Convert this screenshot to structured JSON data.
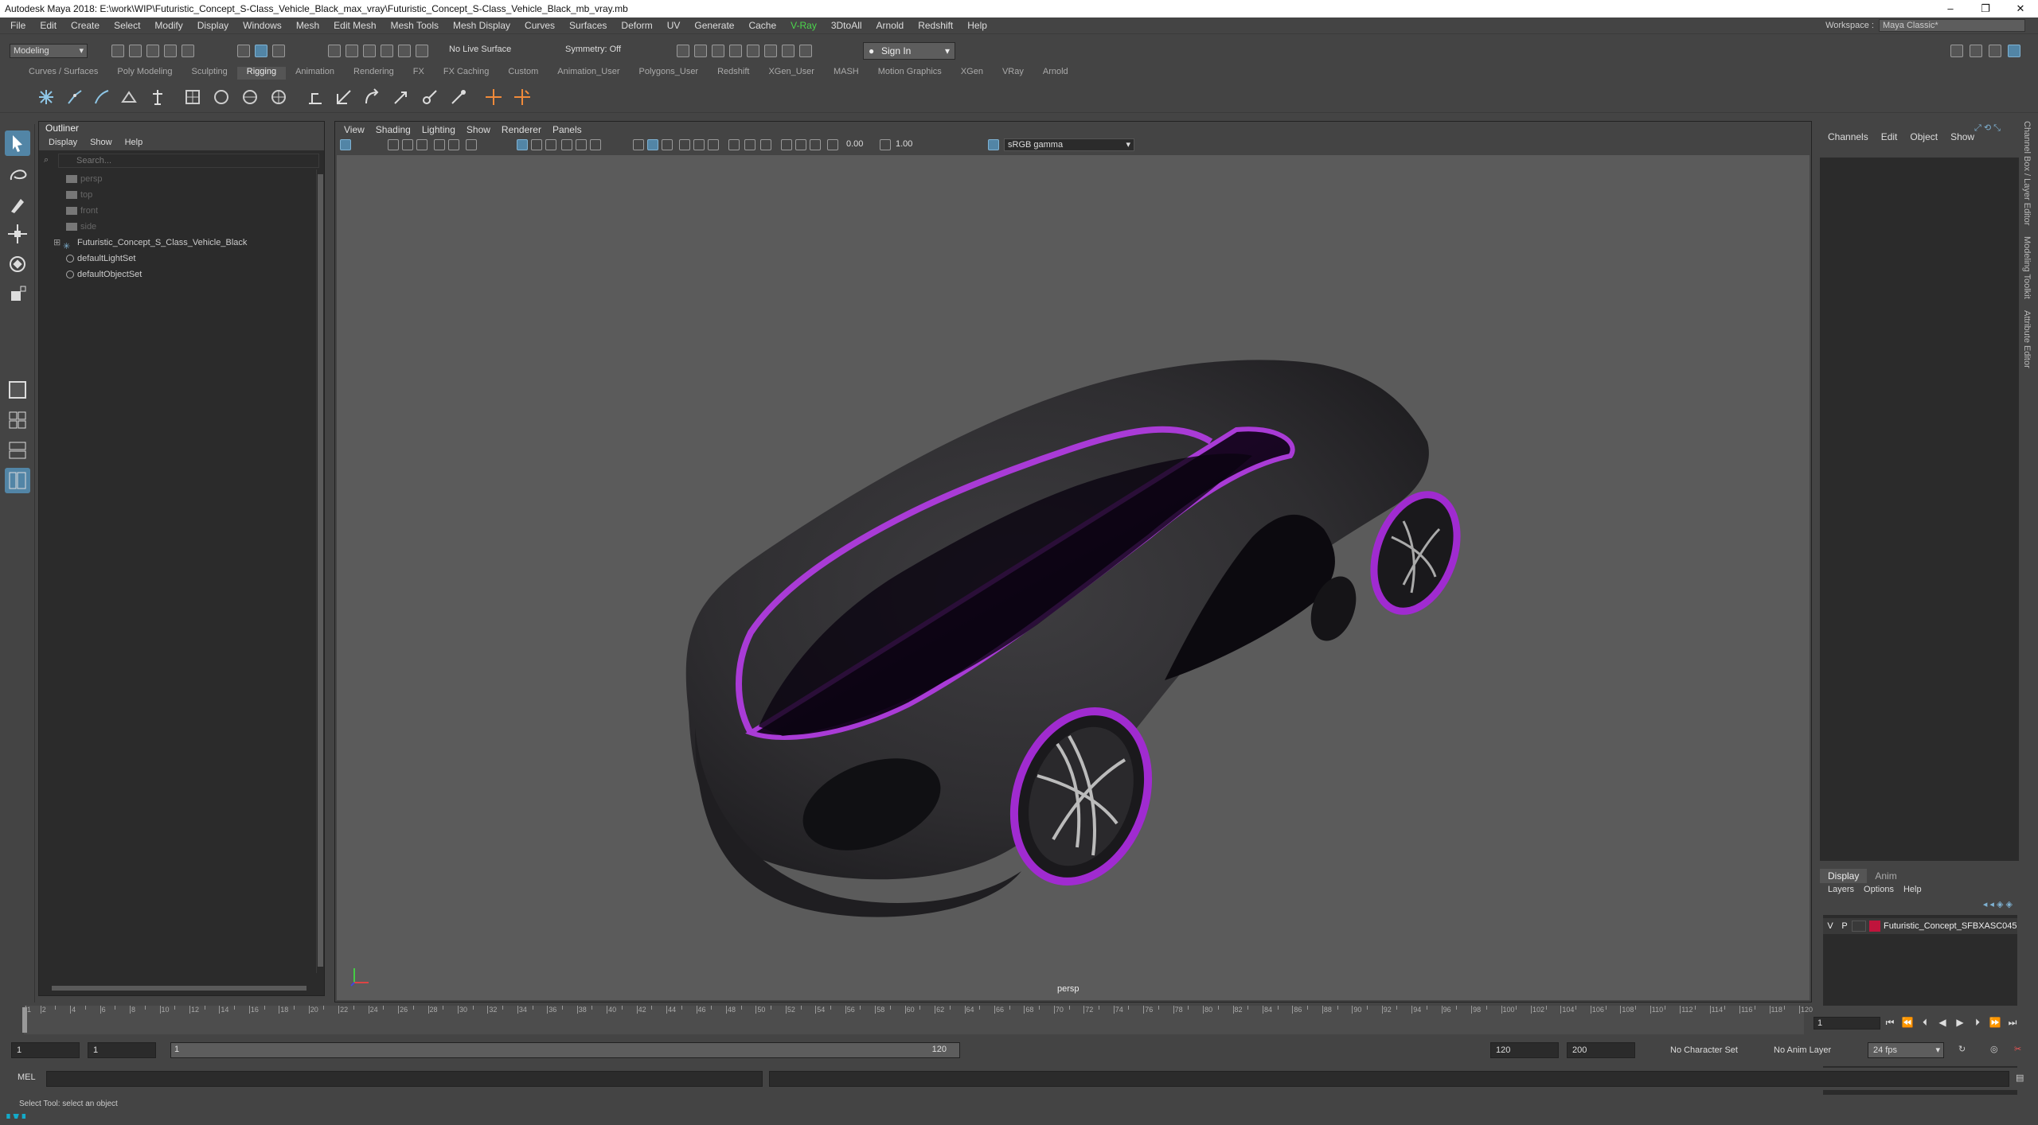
{
  "window": {
    "title": "Autodesk Maya 2018: E:\\work\\WIP\\Futuristic_Concept_S-Class_Vehicle_Black_max_vray\\Futuristic_Concept_S-Class_Vehicle_Black_mb_vray.mb",
    "minimize": "–",
    "restore": "❐",
    "close": "✕"
  },
  "menus": [
    "File",
    "Edit",
    "Create",
    "Select",
    "Modify",
    "Display",
    "Windows",
    "Mesh",
    "Edit Mesh",
    "Mesh Tools",
    "Mesh Display",
    "Curves",
    "Surfaces",
    "Deform",
    "UV",
    "Generate",
    "Cache",
    "V-Ray",
    "3DtoAll",
    "Arnold",
    "Redshift",
    "Help"
  ],
  "workspace": {
    "label": "Workspace :",
    "value": "Maya Classic*"
  },
  "status": {
    "mode": "Modeling",
    "live_surface": "No Live Surface",
    "symmetry": "Symmetry: Off",
    "sign_in": "Sign In"
  },
  "shelf_tabs": [
    "Curves / Surfaces",
    "Poly Modeling",
    "Sculpting",
    "Rigging",
    "Animation",
    "Rendering",
    "FX",
    "FX Caching",
    "Custom",
    "Animation_User",
    "Polygons_User",
    "Redshift",
    "XGen_User",
    "MASH",
    "Motion Graphics",
    "XGen",
    "VRay",
    "Arnold"
  ],
  "active_shelf_tab": "Rigging",
  "outliner": {
    "title": "Outliner",
    "menu": [
      "Display",
      "Show",
      "Help"
    ],
    "search_placeholder": "Search...",
    "items": [
      {
        "label": "persp",
        "dim": true
      },
      {
        "label": "top",
        "dim": true
      },
      {
        "label": "front",
        "dim": true
      },
      {
        "label": "side",
        "dim": true
      },
      {
        "label": "Futuristic_Concept_S_Class_Vehicle_Black",
        "dim": false
      },
      {
        "label": "defaultLightSet",
        "dim": false
      },
      {
        "label": "defaultObjectSet",
        "dim": false
      }
    ]
  },
  "viewport": {
    "menu": [
      "View",
      "Shading",
      "Lighting",
      "Show",
      "Renderer",
      "Panels"
    ],
    "exposure": "0.00",
    "gamma_value": "1.00",
    "color_space": "sRGB gamma",
    "camera_label": "persp"
  },
  "channel_box": {
    "menu": [
      "Channels",
      "Edit",
      "Object",
      "Show"
    ]
  },
  "layer_editor": {
    "tabs": [
      "Display",
      "Anim"
    ],
    "menu": [
      "Layers",
      "Options",
      "Help"
    ],
    "layer": {
      "v": "V",
      "p": "P",
      "name": "Futuristic_Concept_SFBXASC045",
      "color": "#c0143c"
    }
  },
  "side_tabs": [
    "Channel Box / Layer Editor",
    "Modeling Toolkit",
    "Attribute Editor"
  ],
  "timeline": {
    "ticks": [
      "1",
      "2",
      "4",
      "6",
      "8",
      "10",
      "12",
      "14",
      "16",
      "18",
      "20",
      "22",
      "24",
      "26",
      "28",
      "30",
      "32",
      "34",
      "36",
      "38",
      "40",
      "42",
      "44",
      "46",
      "48",
      "50",
      "52",
      "54",
      "56",
      "58",
      "60",
      "62",
      "64",
      "66",
      "68",
      "70",
      "72",
      "74",
      "76",
      "78",
      "80",
      "82",
      "84",
      "86",
      "88",
      "90",
      "92",
      "94",
      "96",
      "98",
      "100",
      "102",
      "104",
      "106",
      "108",
      "110",
      "112",
      "114",
      "116",
      "118",
      "120"
    ],
    "current_frame": "1"
  },
  "range": {
    "start": "1",
    "playback_start": "1",
    "slider_start": "1",
    "slider_end": "120",
    "playback_end": "120",
    "end": "200",
    "character_set": "No Character Set",
    "anim_layer": "No Anim Layer",
    "fps": "24 fps"
  },
  "mel": {
    "label": "MEL"
  },
  "help_line": "Select Tool: select an object",
  "colors": {
    "accent": "#5285a6",
    "car_rim": "#9b27c9",
    "vray": "#4cd64c"
  }
}
